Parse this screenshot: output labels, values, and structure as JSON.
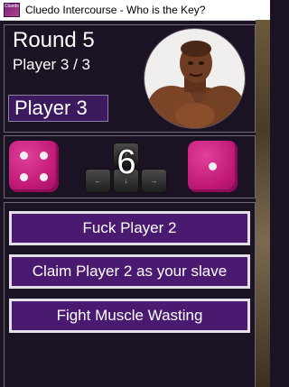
{
  "window": {
    "title": "Cluedo Intercourse - Who is the Key?",
    "icon_text": "Cluedo"
  },
  "status": {
    "round": "Round 5",
    "player_count": "Player 3 / 3",
    "current_player": "Player 3"
  },
  "dice": {
    "left_value": 4,
    "right_value": 1,
    "roll_total": "6"
  },
  "controls": {
    "up": "↑",
    "left": "←",
    "down": "↓",
    "right": "→"
  },
  "actions": [
    {
      "label": "Fuck Player 2"
    },
    {
      "label": "Claim Player 2 as your slave"
    },
    {
      "label": "Fight Muscle Wasting"
    }
  ],
  "colors": {
    "background": "#1b1224",
    "button": "#4a1a70",
    "die": "#c21a78"
  }
}
